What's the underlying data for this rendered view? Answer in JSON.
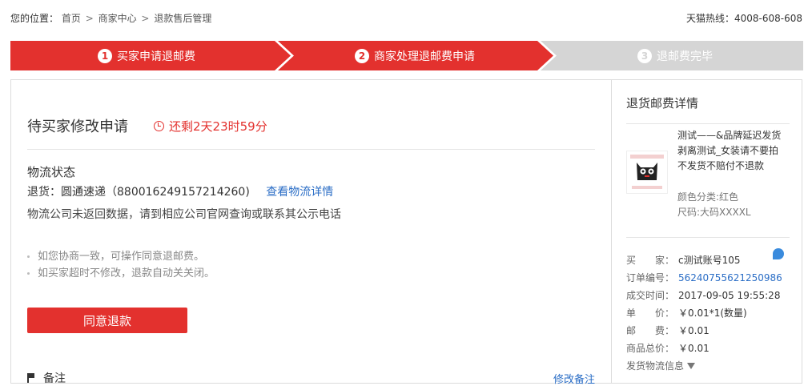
{
  "breadcrumb": {
    "prefix": "您的位置：",
    "items": [
      "首页",
      "商家中心",
      "退款售后管理"
    ],
    "sep": ">"
  },
  "hotline": "天猫热线：4008-608-608",
  "steps": [
    {
      "num": "1",
      "label": "买家申请退邮费",
      "state": "done"
    },
    {
      "num": "2",
      "label": "商家处理退邮费申请",
      "state": "active"
    },
    {
      "num": "3",
      "label": "退邮费完毕",
      "state": "pending"
    }
  ],
  "colors": {
    "accent": "#e3312e",
    "link": "#2b6ec6",
    "step_off": "#d5d5d5"
  },
  "status": {
    "title": "待买家修改申请",
    "countdown": "还剩2天23时59分"
  },
  "logistics": {
    "title": "物流状态",
    "line": "退货：圆通速递（880016249157214260)",
    "link": "查看物流详情",
    "note": "物流公司未返回数据，请到相应公司官网查询或联系其公示电话"
  },
  "tips": [
    "如您协商一致，可操作同意退邮费。",
    "如买家超时不修改，退款自动关关闭。"
  ],
  "agree_button": "同意退款",
  "remark": {
    "label": "备注",
    "edit": "修改备注"
  },
  "detail": {
    "title": "退货邮费详情",
    "product_title": "测试——&品牌延迟发货剥离测试_女装请不要拍不发货不赔付不退款",
    "color": "颜色分类:红色",
    "size": "尺码:大码XXXXL",
    "rows": [
      {
        "k": "买　　家：",
        "v": "c测试账号105"
      },
      {
        "k": "订单编号：",
        "v": "56240755621250986"
      },
      {
        "k": "成交时间：",
        "v": "2017-09-05 19:55:28"
      },
      {
        "k": "单　　价：",
        "v": "￥0.01*1(数量)"
      },
      {
        "k": "邮　　费：",
        "v": "￥0.01"
      },
      {
        "k": "商品总价：",
        "v": "￥0.01"
      }
    ],
    "ship_info": "发货物流信息"
  }
}
